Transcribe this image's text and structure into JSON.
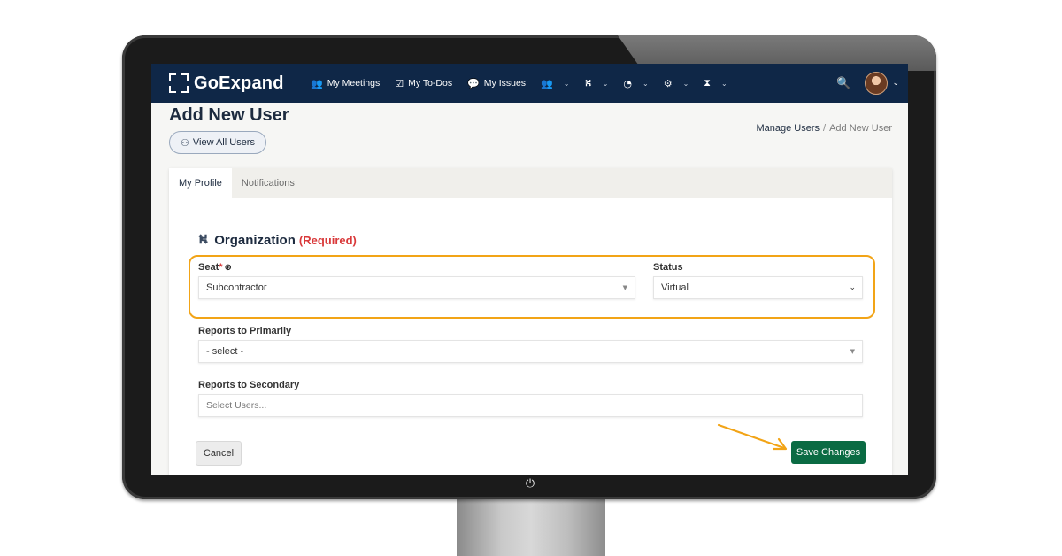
{
  "nav": {
    "brand": "GoExpand",
    "items": [
      {
        "label": "My Meetings",
        "icon": "meetings-icon"
      },
      {
        "label": "My To-Dos",
        "icon": "checkbox-icon"
      },
      {
        "label": "My Issues",
        "icon": "chat-icon"
      }
    ],
    "menus": [
      "people-icon",
      "org-chart-icon",
      "dashboard-icon",
      "gear-icon",
      "hourglass-icon"
    ]
  },
  "header": {
    "title": "Add New User",
    "view_all_label": "View All Users",
    "breadcrumb": {
      "parent": "Manage Users",
      "separator": "/",
      "current": "Add New User"
    }
  },
  "tabs": [
    {
      "label": "My Profile",
      "active": true
    },
    {
      "label": "Notifications",
      "active": false
    }
  ],
  "organization": {
    "title": "Organization",
    "required_label": "(Required)",
    "seat": {
      "label": "Seat",
      "required_mark": "*",
      "value": "Subcontractor"
    },
    "status": {
      "label": "Status",
      "value": "Virtual"
    },
    "reports_primary": {
      "label": "Reports to Primarily",
      "value": "- select -"
    },
    "reports_secondary": {
      "label": "Reports to Secondary",
      "placeholder": "Select Users..."
    }
  },
  "actions": {
    "cancel_label": "Cancel",
    "save_label": "Save Changes"
  },
  "colors": {
    "nav_bg": "#0f2747",
    "highlight": "#f2a417",
    "required": "#d9393a",
    "save_button": "#0a6b43"
  }
}
